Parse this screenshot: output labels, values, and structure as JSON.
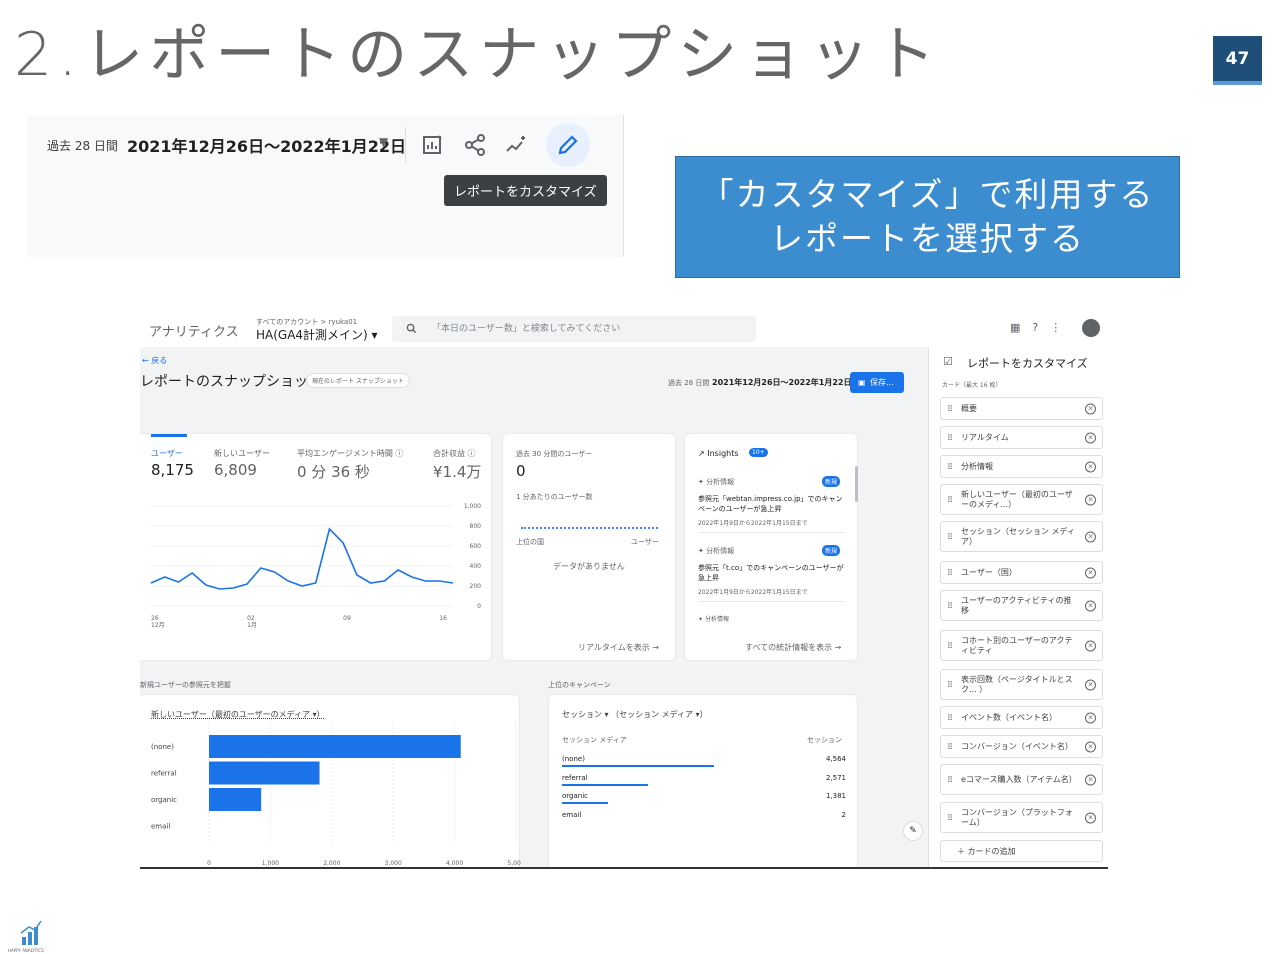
{
  "slide": {
    "title": "2.レポートのスナップショット",
    "page": "47"
  },
  "header_shot": {
    "period": "過去 28 日間",
    "dates": "2021年12月26日～2022年1月22日",
    "tooltip": "レポートをカスタマイズ"
  },
  "callout": {
    "line1": "「カスタマイズ」で利用する",
    "line2": "レポートを選択する"
  },
  "ga": {
    "brand": "アナリティクス",
    "account_path": "すべてのアカウント > ryuka01",
    "property": "HA(GA4計測メイン) ▾",
    "search_placeholder": "「本日のユーザー数」と検索してみてください",
    "back": "← 戻る",
    "title": "レポートのスナップショット",
    "chip": "現在のレポート スナップショット",
    "period": "過去 28 日間",
    "dates": "2021年12月26日～2022年1月22日",
    "save": "保存..."
  },
  "metrics": [
    {
      "label": "ユーザー",
      "value": "8,175"
    },
    {
      "label": "新しいユーザー",
      "value": "6,809"
    },
    {
      "label": "平均エンゲージメント時間 ⓘ",
      "value": "0 分 36 秒"
    },
    {
      "label": "合計収益 ⓘ",
      "value": "¥1.4万"
    }
  ],
  "chart_data": {
    "type": "line",
    "x_ticks": [
      "26\n12月",
      "02\n1月",
      "09",
      "16"
    ],
    "y_ticks": [
      "1,000",
      "800",
      "600",
      "400",
      "200",
      "0"
    ],
    "ylim": [
      0,
      1000
    ],
    "values": [
      230,
      290,
      240,
      330,
      210,
      170,
      180,
      220,
      380,
      340,
      250,
      200,
      230,
      770,
      630,
      310,
      230,
      250,
      360,
      290,
      250,
      250,
      230
    ]
  },
  "realtime": {
    "title": "過去 30 分間のユーザー",
    "value": "0",
    "per_minute": "1 分あたりのユーザー数",
    "col_country": "上位の国",
    "col_users": "ユーザー",
    "empty": "データがありません",
    "link": "リアルタイムを表示 →"
  },
  "insights": {
    "title": "Insights",
    "badge": "10+",
    "items": [
      {
        "type": "分析情報",
        "tag": "新規",
        "text": "参照元「webtan.impress.co.jp」でのキャンペーンのユーザーが急上昇",
        "date": "2022年1月9日から2022年1月15日まで"
      },
      {
        "type": "分析情報",
        "tag": "新規",
        "text": "参照元「t.co」でのキャンペーンのユーザーが急上昇",
        "date": "2022年1月9日から2022年1月15日まで"
      },
      {
        "type": "分析情報"
      }
    ],
    "link": "すべての統計情報を表示 →"
  },
  "acquisition": {
    "section": "新規ユーザーの参照元を把握",
    "dim": "新しいユーザー（最初のユーザーのメディア ▾）",
    "chart_data": {
      "type": "bar",
      "categories": [
        "(none)",
        "referral",
        "organic",
        "email"
      ],
      "values": [
        4100,
        1800,
        850,
        0
      ],
      "x_ticks": [
        "0",
        "1,000",
        "2,000",
        "3,000",
        "4,000",
        "5,000"
      ],
      "xlim": [
        0,
        5000
      ]
    }
  },
  "campaigns": {
    "section": "上位のキャンペーン",
    "dim": "セッション ▾ （セッション メディア ▾）",
    "col1": "セッション メディア",
    "col2": "セッション",
    "rows": [
      {
        "name": "(none)",
        "value": "4,564",
        "n": 4564
      },
      {
        "name": "referral",
        "value": "2,571",
        "n": 2571
      },
      {
        "name": "organic",
        "value": "1,381",
        "n": 1381
      },
      {
        "name": "email",
        "value": "2",
        "n": 2
      }
    ]
  },
  "sidebar": {
    "title": "レポートをカスタマイズ",
    "subtitle": "カード（最大 16 枚）",
    "items": [
      "概要",
      "リアルタイム",
      "分析情報",
      "新しいユーザー（最初のユーザーのメディ...）",
      "セッション（セッション メディア）",
      "ユーザー（国）",
      "ユーザーのアクティビティの推移",
      "コホート別のユーザーのアクティビティ",
      "表示回数（ページタイトルとスク... ）",
      "イベント数（イベント名）",
      "コンバージョン（イベント名）",
      "eコマース購入数（アイテム名）",
      "コンバージョン（プラットフォーム）"
    ],
    "add": "＋ カードの追加"
  },
  "logo_text": "HAPPY ANALYTICS"
}
